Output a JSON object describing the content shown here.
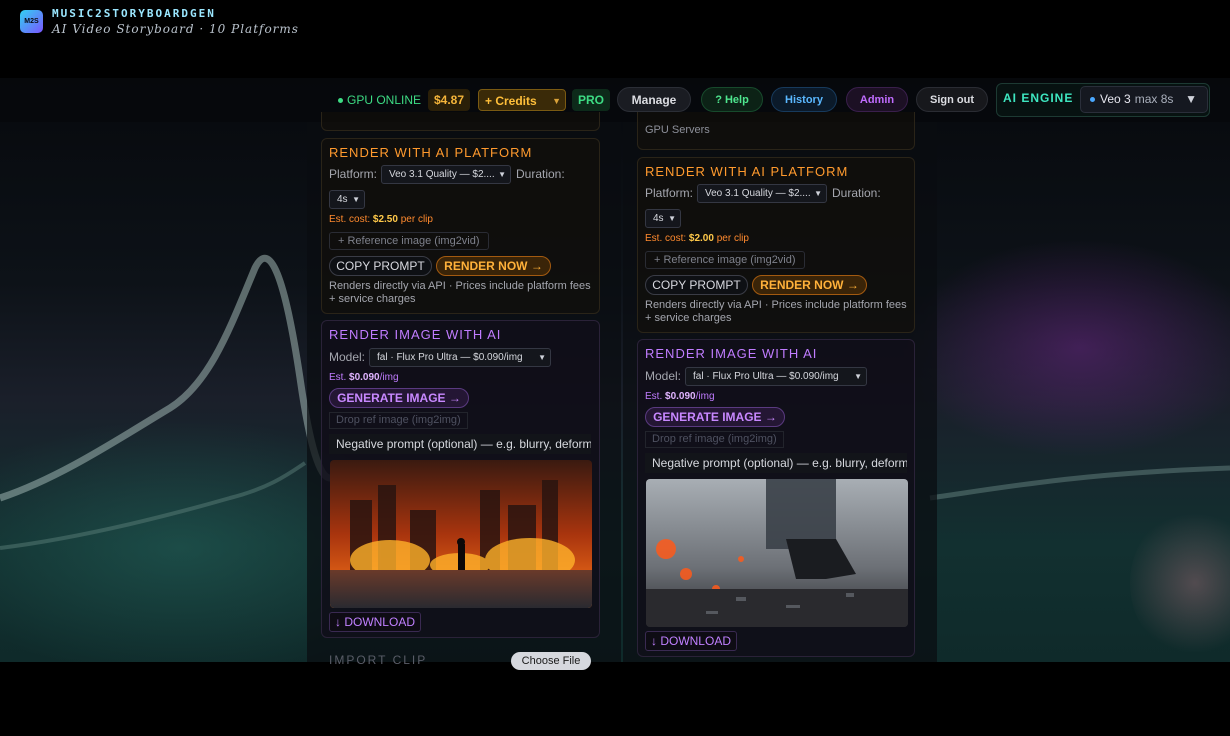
{
  "header": {
    "logo_badge": "M2S",
    "app_title": "MUSIC2STORYBOARDGEN",
    "subtitle": "AI Video Storyboard · 10 Platforms",
    "gpu_status": "GPU ONLINE",
    "balance": "$4.87",
    "credits_label": "+ Credits",
    "pro_badge": "PRO",
    "manage_label": "Manage",
    "help_label": "? Help",
    "history_label": "History",
    "admin_label": "Admin",
    "signout_label": "Sign out",
    "engine_label": "AI ENGINE",
    "engine_model": "Veo 3",
    "engine_max": "max 8s"
  },
  "left": {
    "render": {
      "title": "RENDER WITH AI PLATFORM",
      "platform_label": "Platform:",
      "platform_value": "Veo 3.1 Quality — $2....",
      "duration_label": "Duration:",
      "duration_value": "4s",
      "est_prefix": "Est. cost:",
      "est_value": "$2.50",
      "est_suffix": "per clip",
      "reference_label": "+ Reference image (img2vid)",
      "copy_label": "COPY PROMPT",
      "render_label": "RENDER NOW →",
      "note": "Renders directly via API · Prices include platform fees + service charges"
    },
    "image": {
      "title": "RENDER IMAGE WITH AI",
      "model_label": "Model:",
      "model_value": "fal · Flux Pro Ultra — $0.090/img",
      "est_prefix": "Est.",
      "est_value": "$0.090",
      "est_suffix": "/img",
      "generate_label": "GENERATE IMAGE →",
      "drop_label": "Drop ref image (img2img)",
      "negative_placeholder": "Negative prompt (optional) — e.g. blurry, deform",
      "download_label": "↓ DOWNLOAD"
    },
    "import_label": "IMPORT CLIP",
    "choose_file_label": "Choose File"
  },
  "right": {
    "gpu_servers": "GPU Servers",
    "render": {
      "title": "RENDER WITH AI PLATFORM",
      "platform_label": "Platform:",
      "platform_value": "Veo 3.1 Quality — $2....",
      "duration_label": "Duration:",
      "duration_value": "4s",
      "est_prefix": "Est. cost:",
      "est_value": "$2.00",
      "est_suffix": "per clip",
      "reference_label": "+ Reference image (img2vid)",
      "copy_label": "COPY PROMPT",
      "render_label": "RENDER NOW →",
      "note": "Renders directly via API · Prices include platform fees + service charges"
    },
    "image": {
      "title": "RENDER IMAGE WITH AI",
      "model_label": "Model:",
      "model_value": "fal · Flux Pro Ultra — $0.090/img",
      "est_prefix": "Est.",
      "est_value": "$0.090",
      "est_suffix": "/img",
      "generate_label": "GENERATE IMAGE →",
      "drop_label": "Drop ref image (img2img)",
      "negative_placeholder": "Negative prompt (optional) — e.g. blurry, deform",
      "download_label": "↓ DOWNLOAD"
    }
  },
  "colors": {
    "accent_orange": "#ff9a2e",
    "accent_violet": "#c07cff",
    "status_green": "#3ddc84",
    "engine_teal": "#3ee6c0"
  }
}
